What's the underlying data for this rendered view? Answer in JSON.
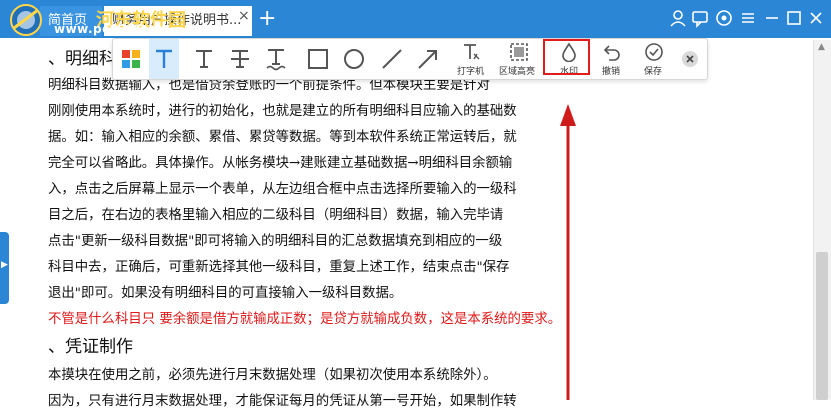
{
  "titlebar": {
    "home_tab": "简首页",
    "doc_tab": "财务用户操作说明书...",
    "tab_close": "×",
    "tab_add": "+",
    "watermark_line1": "河东软件园",
    "watermark_line2": "www.pc0359.cn"
  },
  "toolbar": {
    "typewriter_label": "打字机",
    "area_highlight_label": "区域高亮",
    "watermark_label": "水印",
    "undo_label": "撤销",
    "save_label": "保存"
  },
  "document": {
    "lines": [
      "、明细科",
      "明细科目数据输入，也是借贷余登账的一个前提条件。但本模块主要是针对",
      "刚刚使用本系统时，进行的初始化，也就是建立的所有明细科目应输入的基础数",
      "据。如：输入相应的余额、累借、累贷等数据。等到本软件系统正常运转后，就",
      "完全可以省略此。具体操作。从帐务模块→建账建立基础数据→明细科目余额输",
      "入，点击之后屏幕上显示一个表单，从左边组合框中点击选择所要输入的一级科",
      "目之后，在右边的表格里输入相应的二级科目（明细科目）数据，输入完毕请",
      "点击\"更新一级科目数据\"即可将输入的明细科目的汇总数据填充到相应的一级",
      "科目中去，正确后，可重新选择其他一级科目，重复上述工作，结束点击\"保存",
      "退出\"即可。如果没有明细科目的可直接输入一级科目数据。",
      "不管是什么科目只 要余额是借方就输成正数；是贷方就输成负数，这是本系统的要求。",
      "、凭证制作",
      "本摸块在使用之前，必须先进行月末数据处理（如果初次使用本系统除外）。",
      "因为，只有进行月末数据处理，才能保证每月的凭证从第一号开始，如果制作转"
    ]
  },
  "colors": {
    "titlebar": "#2b86d6",
    "highlight": "#e21c1c",
    "red_text": "#e01818"
  }
}
